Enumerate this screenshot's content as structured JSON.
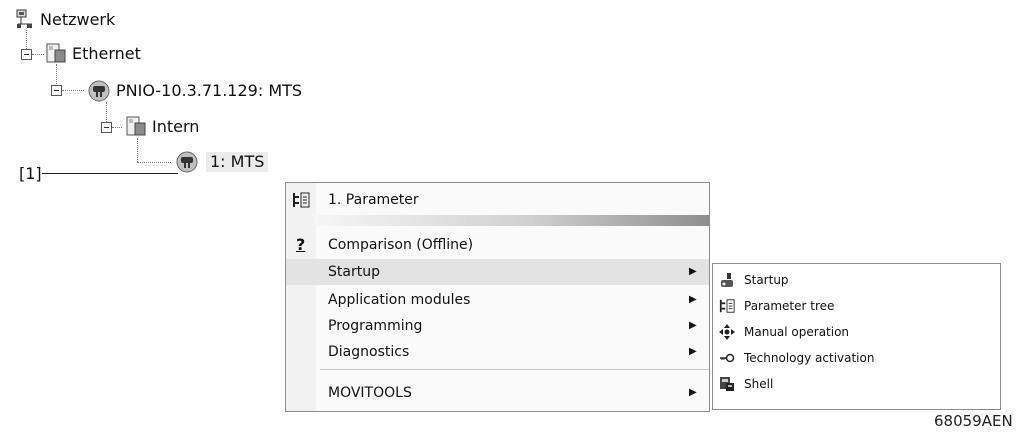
{
  "tree": {
    "root": {
      "label": "Netzwerk",
      "icon": "network-icon"
    },
    "ethernet": {
      "label": "Ethernet",
      "icon": "bus-segment-icon"
    },
    "pnio": {
      "label": "PNIO-10.3.71.129: MTS",
      "icon": "device-icon"
    },
    "intern": {
      "label": "Intern",
      "icon": "bus-segment-icon"
    },
    "mts": {
      "label": "1: MTS",
      "icon": "device-icon"
    }
  },
  "callout": {
    "label": "[1]"
  },
  "menu": {
    "items": [
      {
        "label": "1. Parameter",
        "icon": "parameter-tree-icon",
        "submenu": false
      },
      {
        "label": "Comparison (Offline)",
        "icon": "question-icon",
        "submenu": false
      },
      {
        "label": "Startup",
        "icon": "",
        "submenu": true,
        "active": true
      },
      {
        "label": "Application modules",
        "icon": "",
        "submenu": true
      },
      {
        "label": "Programming",
        "icon": "",
        "submenu": true
      },
      {
        "label": "Diagnostics",
        "icon": "",
        "submenu": true
      },
      {
        "label": "MOVITOOLS",
        "icon": "",
        "submenu": true
      }
    ],
    "arrow": "▶"
  },
  "submenu": {
    "items": [
      {
        "label": "Startup",
        "icon": "startup-icon"
      },
      {
        "label": "Parameter tree",
        "icon": "parameter-tree-icon"
      },
      {
        "label": "Manual operation",
        "icon": "manual-operation-icon"
      },
      {
        "label": "Technology activation",
        "icon": "key-icon"
      },
      {
        "label": "Shell",
        "icon": "shell-icon"
      }
    ]
  },
  "figure_id": "68059AEN"
}
